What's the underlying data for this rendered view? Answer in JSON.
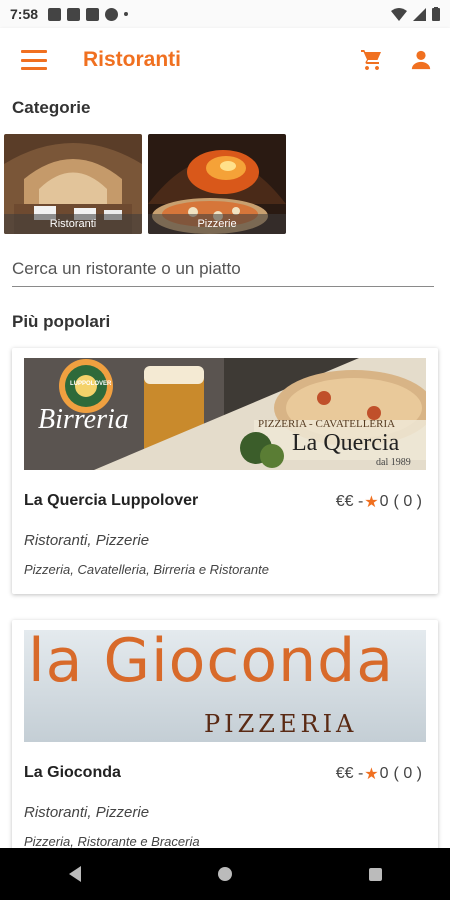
{
  "status_bar": {
    "time": "7:58"
  },
  "app_bar": {
    "title": "Ristoranti",
    "icons": [
      "menu-icon",
      "cart-icon",
      "account-icon"
    ],
    "accent_color": "#f07020"
  },
  "categories": {
    "title": "Categorie",
    "items": [
      {
        "label": "Ristoranti"
      },
      {
        "label": "Pizzerie"
      }
    ]
  },
  "search": {
    "placeholder": "Cerca un ristorante o un piatto"
  },
  "popular": {
    "title": "Più popolari",
    "restaurants": [
      {
        "name": "La Quercia Luppolover",
        "price": "€€ -",
        "rating": "0",
        "reviews": "( 0 )",
        "categories": "Ristoranti, Pizzerie",
        "description": "Pizzeria, Cavatelleria, Birreria e Ristorante",
        "banner": {
          "left_text": "Birreria",
          "brand": "LUPPOLOVER",
          "right_top": "PIZZERIA - CAVATELLERIA",
          "right_name": "La Quercia",
          "right_since": "dal 1989"
        }
      },
      {
        "name": "La Gioconda",
        "price": "€€ -",
        "rating": "0",
        "reviews": "( 0 )",
        "categories": "Ristoranti, Pizzerie",
        "description": "Pizzeria, Ristorante e Braceria",
        "banner": {
          "title": "la Gioconda",
          "subtitle": "PIZZERIA"
        }
      }
    ]
  }
}
